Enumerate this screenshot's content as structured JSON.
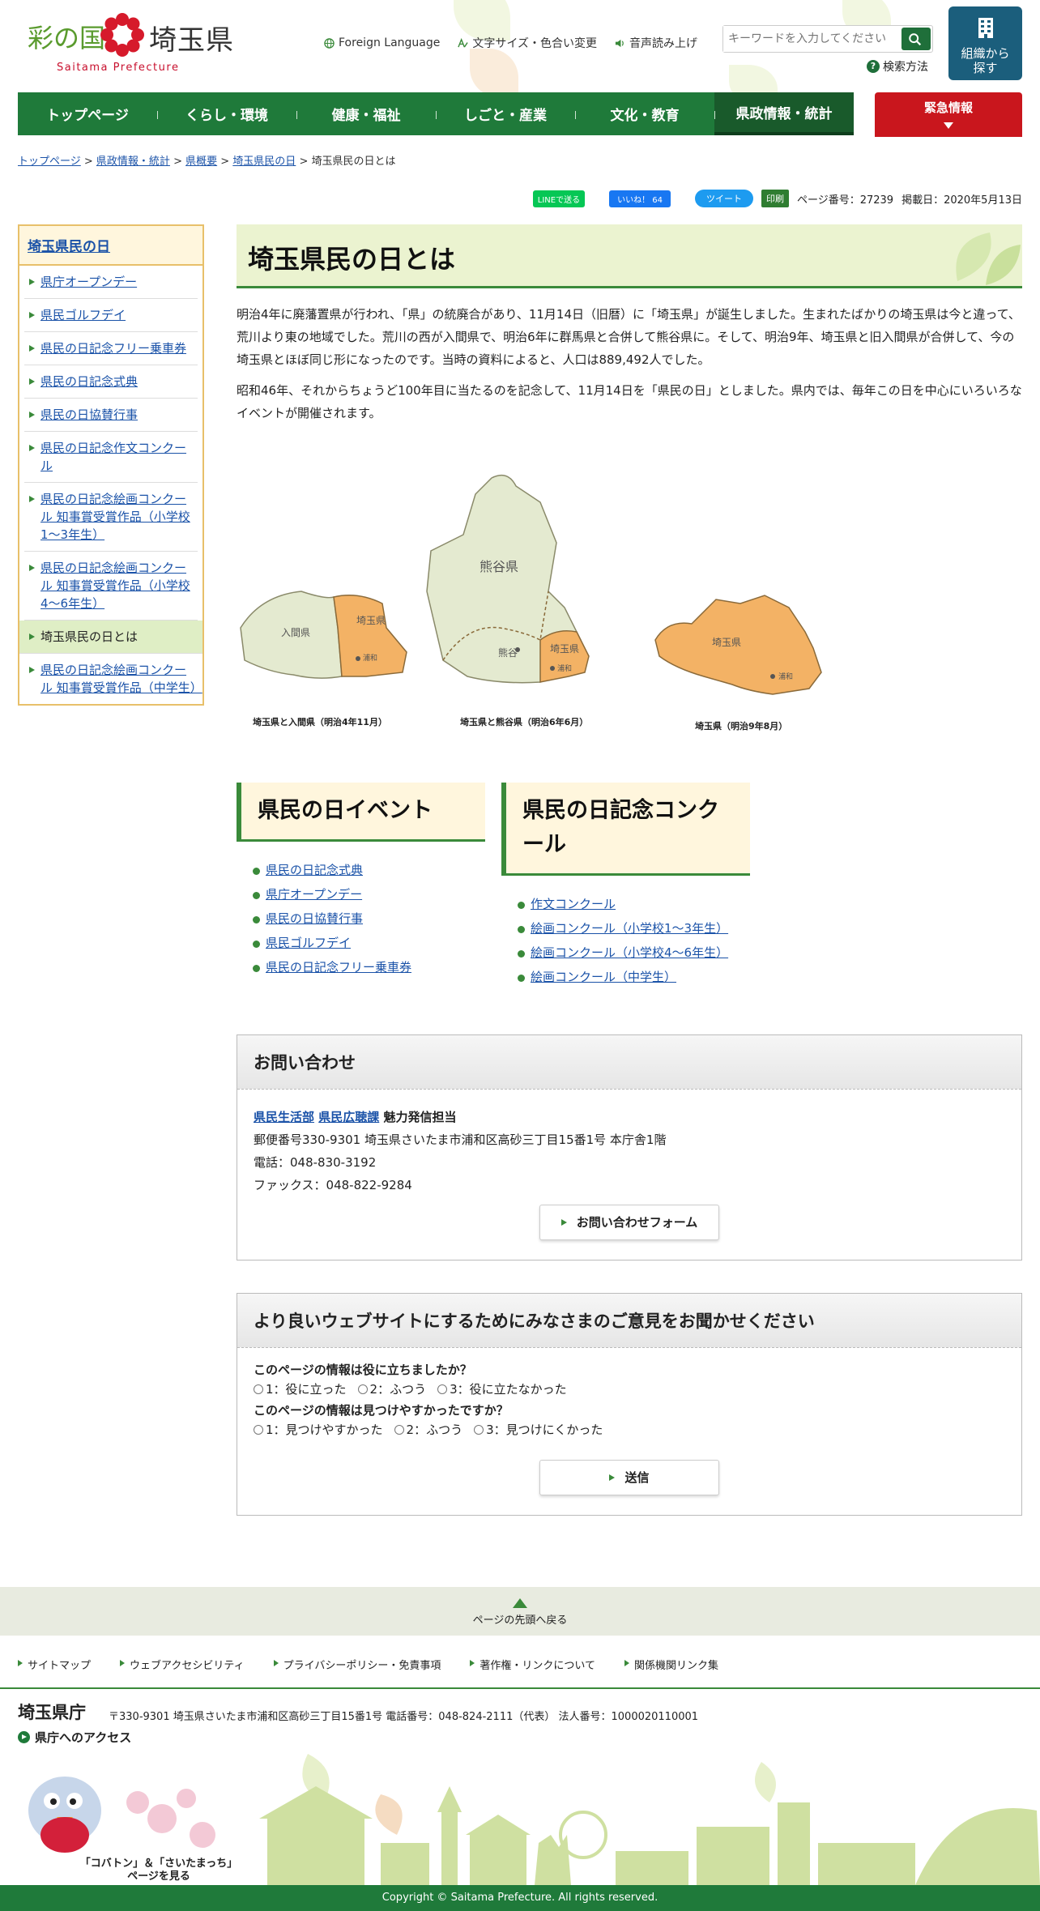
{
  "header": {
    "logo_sai": "彩の国",
    "logo_name": "埼玉県",
    "logo_en": "Saitama Prefecture",
    "foreign_language": "Foreign Language",
    "text_size": "文字サイズ・色合い変更",
    "voice": "音声読み上げ",
    "search_placeholder": "キーワードを入力してください",
    "search_help": "検索方法",
    "org_button": "組織から探す"
  },
  "gnav": [
    "トップページ",
    "くらし・環境",
    "健康・福祉",
    "しごと・産業",
    "文化・教育",
    "県政情報・統計"
  ],
  "emergency": "緊急情報",
  "breadcrumb": {
    "items": [
      "トップページ",
      "県政情報・統計",
      "県概要",
      "埼玉県民の日"
    ],
    "current": "埼玉県民の日とは",
    "sep": " > "
  },
  "share": {
    "line": "LINEで送る",
    "fb": "いいね！ 64",
    "tw": "ツイート",
    "print": "印刷",
    "page_no": "ページ番号：27239",
    "date": "掲載日：2020年5月13日"
  },
  "side": {
    "title": "埼玉県民の日",
    "items": [
      "県庁オープンデー",
      "県民ゴルフデイ",
      "県民の日記念フリー乗車券",
      "県民の日記念式典",
      "県民の日協賛行事",
      "県民の日記念作文コンクール",
      "県民の日記念絵画コンクール 知事賞受賞作品（小学校1～3年生）",
      "県民の日記念絵画コンクール 知事賞受賞作品（小学校4～6年生）",
      "埼玉県民の日とは",
      "県民の日記念絵画コンクール 知事賞受賞作品（中学生）"
    ]
  },
  "main": {
    "title": "埼玉県民の日とは",
    "p1": "明治4年に廃藩置県が行われ、「県」の統廃合があり、11月14日（旧暦）に「埼玉県」が誕生しました。生まれたばかりの埼玉県は今と違って、荒川より東の地域でした。荒川の西が入間県で、明治6年に群馬県と合併して熊谷県に。そして、明治9年、埼玉県と旧入間県が合併して、今の埼玉県とほぼ同じ形になったのです。当時の資料によると、人口は889,492人でした。",
    "p2": "昭和46年、それからちょうど100年目に当たるのを記念して、11月14日を「県民の日」としました。県内では、毎年この日を中心にいろいろなイベントが開催されます。"
  },
  "maps": {
    "m1": {
      "iruma": "入間県",
      "saitama": "埼玉県",
      "urawa": "浦和",
      "caption": "埼玉県と入間県（明治4年11月）"
    },
    "m2": {
      "kumagaya": "熊谷県",
      "kumagaya_city": "熊谷",
      "saitama": "埼玉県",
      "urawa": "浦和",
      "caption": "埼玉県と熊谷県（明治6年6月）"
    },
    "m3": {
      "saitama": "埼玉県",
      "urawa": "浦和",
      "caption": "埼玉県（明治9年8月）"
    }
  },
  "events": {
    "title": "県民の日イベント",
    "items": [
      "県民の日記念式典",
      "県庁オープンデー",
      "県民の日協賛行事",
      "県民ゴルフデイ",
      "県民の日記念フリー乗車券"
    ]
  },
  "contests": {
    "title": "県民の日記念コンクール",
    "items": [
      "作文コンクール",
      "絵画コンクール（小学校1～3年生）",
      "絵画コンクール（小学校4～6年生）",
      "絵画コンクール（中学生）"
    ]
  },
  "contact": {
    "title": "お問い合わせ",
    "dept": "県民生活部",
    "section": "県民広聴課",
    "staff": "魅力発信担当",
    "address": "郵便番号330-9301 埼玉県さいたま市浦和区高砂三丁目15番1号 本庁舎1階",
    "tel": "電話：048-830-3192",
    "fax": "ファックス：048-822-9284",
    "form_button": "お問い合わせフォーム"
  },
  "survey": {
    "title": "より良いウェブサイトにするためにみなさまのご意見をお聞かせください",
    "q1": "このページの情報は役に立ちましたか？",
    "q1_options": [
      "1：役に立った",
      "2：ふつう",
      "3：役に立たなかった"
    ],
    "q2": "このページの情報は見つけやすかったですか？",
    "q2_options": [
      "1：見つけやすかった",
      "2：ふつう",
      "3：見つけにくかった"
    ],
    "submit": "送信"
  },
  "footer": {
    "pagetop": "ページの先頭へ戻る",
    "links": [
      "サイトマップ",
      "ウェブアクセシビリティ",
      "プライバシーポリシー・免責事項",
      "著作権・リンクについて",
      "関係機関リンク集"
    ],
    "name": "埼玉県庁",
    "address": "〒330-9301 埼玉県さいたま市浦和区高砂三丁目15番1号 電話番号：048-824-2111（代表） 法人番号：1000020110001",
    "access": "県庁へのアクセス",
    "mascot_caption": "「コバトン」＆「さいたまっち」ページを見る",
    "copyright": "Copyright © Saitama Prefecture. All rights reserved."
  },
  "colors": {
    "brand_green": "#1f7a3a",
    "emergency_red": "#c9161d",
    "map_saitama": "#f3b265",
    "map_other": "#e4ead0"
  }
}
